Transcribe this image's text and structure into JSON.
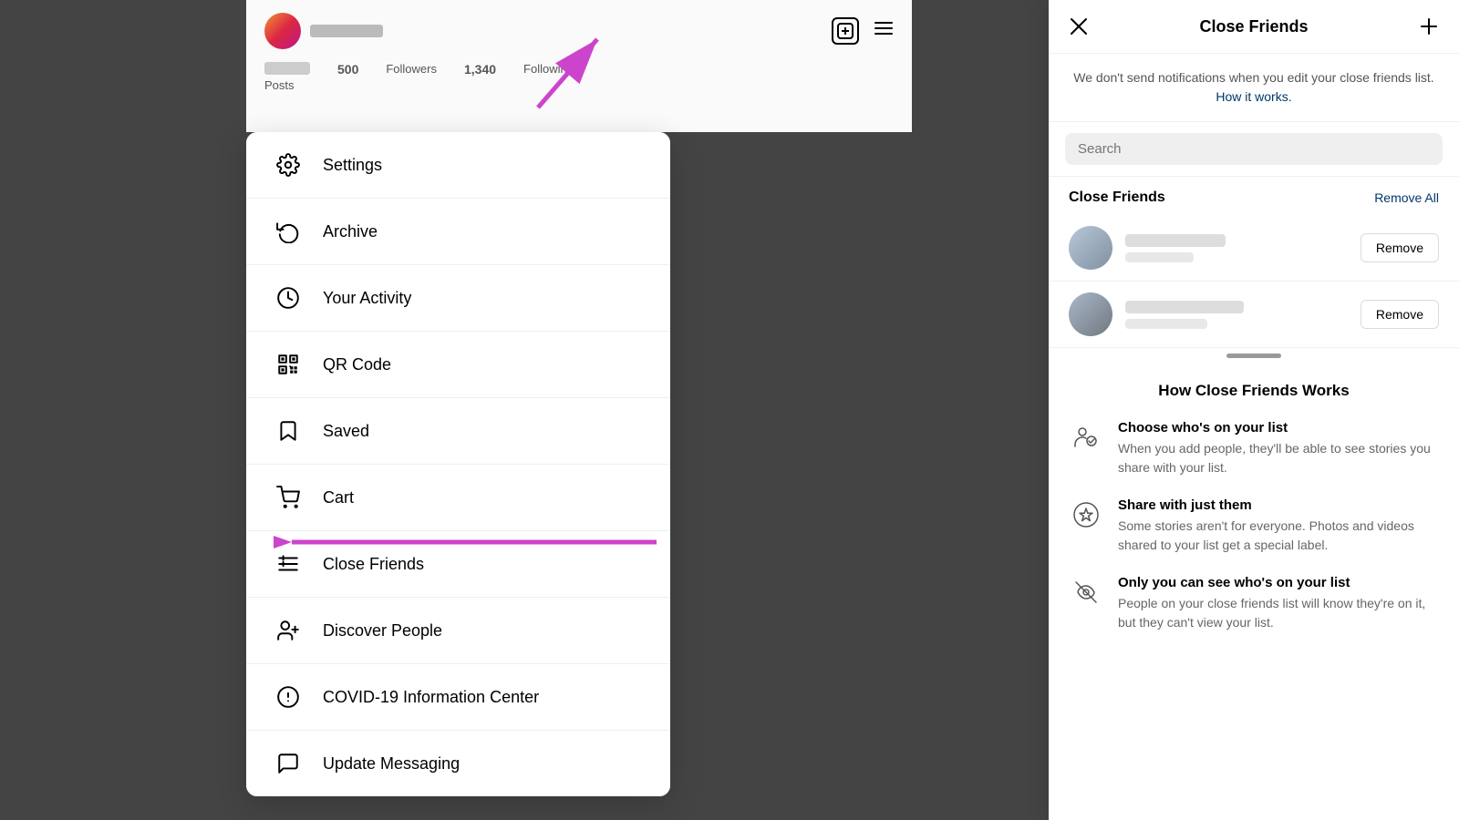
{
  "background": {
    "color": "#888888"
  },
  "ig_profile": {
    "plus_icon": "+",
    "menu_icon": "≡",
    "stats": {
      "posts_label": "Posts",
      "followers_count": "500",
      "followers_label": "Followers",
      "following_count": "1,340",
      "following_label": "Following"
    }
  },
  "menu": {
    "items": [
      {
        "id": "settings",
        "label": "Settings",
        "icon": "settings"
      },
      {
        "id": "archive",
        "label": "Archive",
        "icon": "archive"
      },
      {
        "id": "your-activity",
        "label": "Your Activity",
        "icon": "activity"
      },
      {
        "id": "qr-code",
        "label": "QR Code",
        "icon": "qr"
      },
      {
        "id": "saved",
        "label": "Saved",
        "icon": "saved"
      },
      {
        "id": "cart",
        "label": "Cart",
        "icon": "cart"
      },
      {
        "id": "close-friends",
        "label": "Close Friends",
        "icon": "close-friends"
      },
      {
        "id": "discover-people",
        "label": "Discover People",
        "icon": "discover"
      },
      {
        "id": "covid",
        "label": "COVID-19 Information Center",
        "icon": "covid"
      },
      {
        "id": "update-messaging",
        "label": "Update Messaging",
        "icon": "messaging"
      }
    ]
  },
  "close_friends_panel": {
    "title": "Close Friends",
    "notice": "We don't send notifications when you edit your close friends list.",
    "how_it_works_link": "How it works.",
    "search_placeholder": "Search",
    "section_title": "Close Friends",
    "remove_all_label": "Remove All",
    "remove_button_label": "Remove",
    "friends": [
      {
        "id": "friend-1"
      },
      {
        "id": "friend-2"
      }
    ],
    "how_it_works": {
      "title": "How Close Friends Works",
      "items": [
        {
          "id": "choose",
          "title": "Choose who's on your list",
          "desc": "When you add people, they'll be able to see stories you share with your list.",
          "icon": "people"
        },
        {
          "id": "share",
          "title": "Share with just them",
          "desc": "Some stories aren't for everyone. Photos and videos shared to your list get a special label.",
          "icon": "star"
        },
        {
          "id": "private",
          "title": "Only you can see who's on your list",
          "desc": "People on your close friends list will know they're on it, but they can't view your list.",
          "icon": "eye-off"
        }
      ]
    }
  },
  "arrows": {
    "top_label": "pink arrow pointing up-right to menu icon",
    "middle_label": "pink arrow pointing left to Close Friends"
  }
}
